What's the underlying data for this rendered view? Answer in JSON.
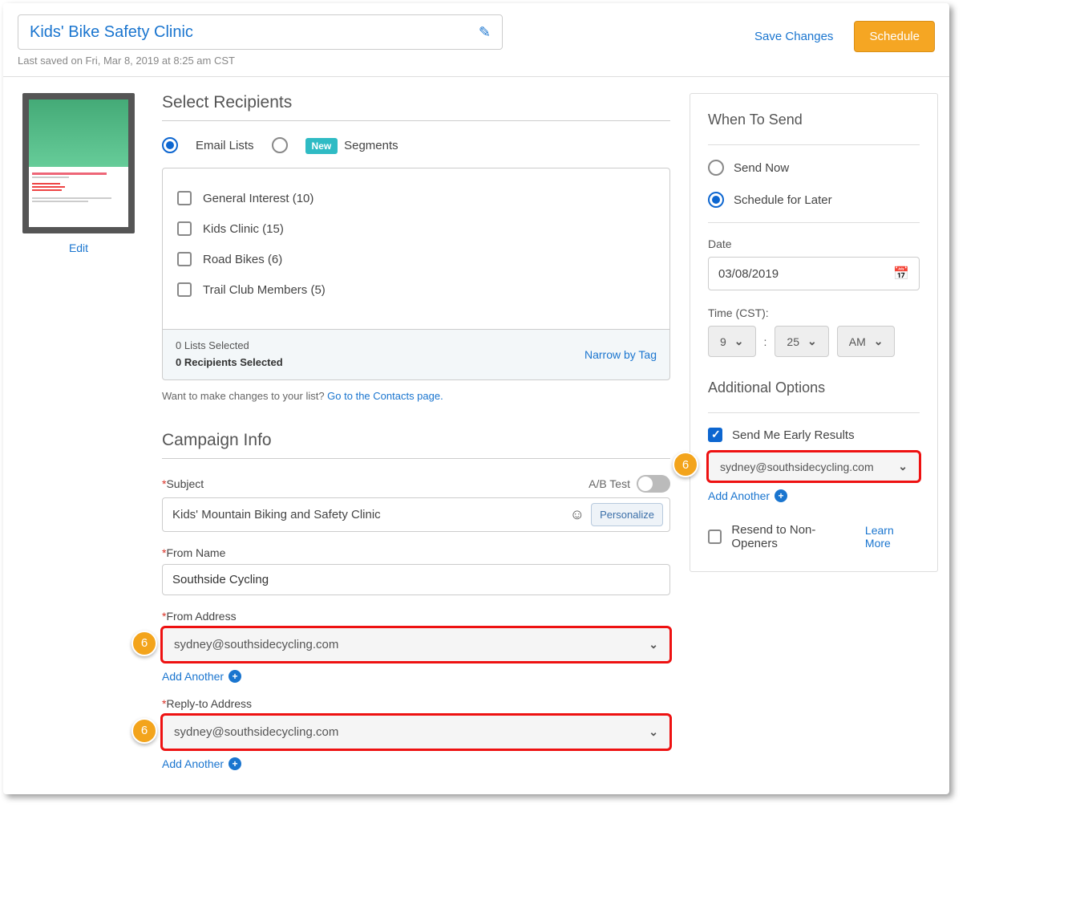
{
  "header": {
    "title": "Kids' Bike Safety Clinic",
    "last_saved": "Last saved on Fri, Mar 8, 2019 at 8:25 am CST",
    "save_changes": "Save Changes",
    "schedule": "Schedule"
  },
  "left": {
    "edit": "Edit"
  },
  "recipients": {
    "title": "Select Recipients",
    "option_lists": "Email Lists",
    "option_segments": "Segments",
    "new_badge": "New",
    "lists": [
      {
        "label": "General Interest (10)"
      },
      {
        "label": "Kids Clinic (15)"
      },
      {
        "label": "Road Bikes (6)"
      },
      {
        "label": "Trail Club Members (5)"
      }
    ],
    "footer_line1": "0 Lists Selected",
    "footer_line2": "0 Recipients Selected",
    "narrow": "Narrow by Tag",
    "helper_prefix": "Want to make changes to your list? ",
    "helper_link": "Go to the Contacts page."
  },
  "campaign": {
    "title": "Campaign Info",
    "subject_label": "Subject",
    "abtest_label": "A/B Test",
    "subject_value": "Kids' Mountain Biking and Safety Clinic",
    "personalize": "Personalize",
    "from_name_label": "From Name",
    "from_name_value": "Southside Cycling",
    "from_addr_label": "From Address",
    "from_addr_value": "sydney@southsidecycling.com",
    "reply_addr_label": "Reply-to Address",
    "reply_addr_value": "sydney@southsidecycling.com",
    "add_another": "Add Another"
  },
  "send": {
    "title": "When To Send",
    "send_now": "Send Now",
    "schedule_later": "Schedule for Later",
    "date_label": "Date",
    "date_value": "03/08/2019",
    "time_label": "Time (CST):",
    "hour": "9",
    "minute": "25",
    "ampm": "AM",
    "additional": "Additional Options",
    "early_results": "Send Me Early Results",
    "early_email": "sydney@southsidecycling.com",
    "add_another": "Add Another",
    "resend": "Resend to Non-Openers",
    "learn_more": "Learn More"
  },
  "markers": {
    "n": "6"
  }
}
